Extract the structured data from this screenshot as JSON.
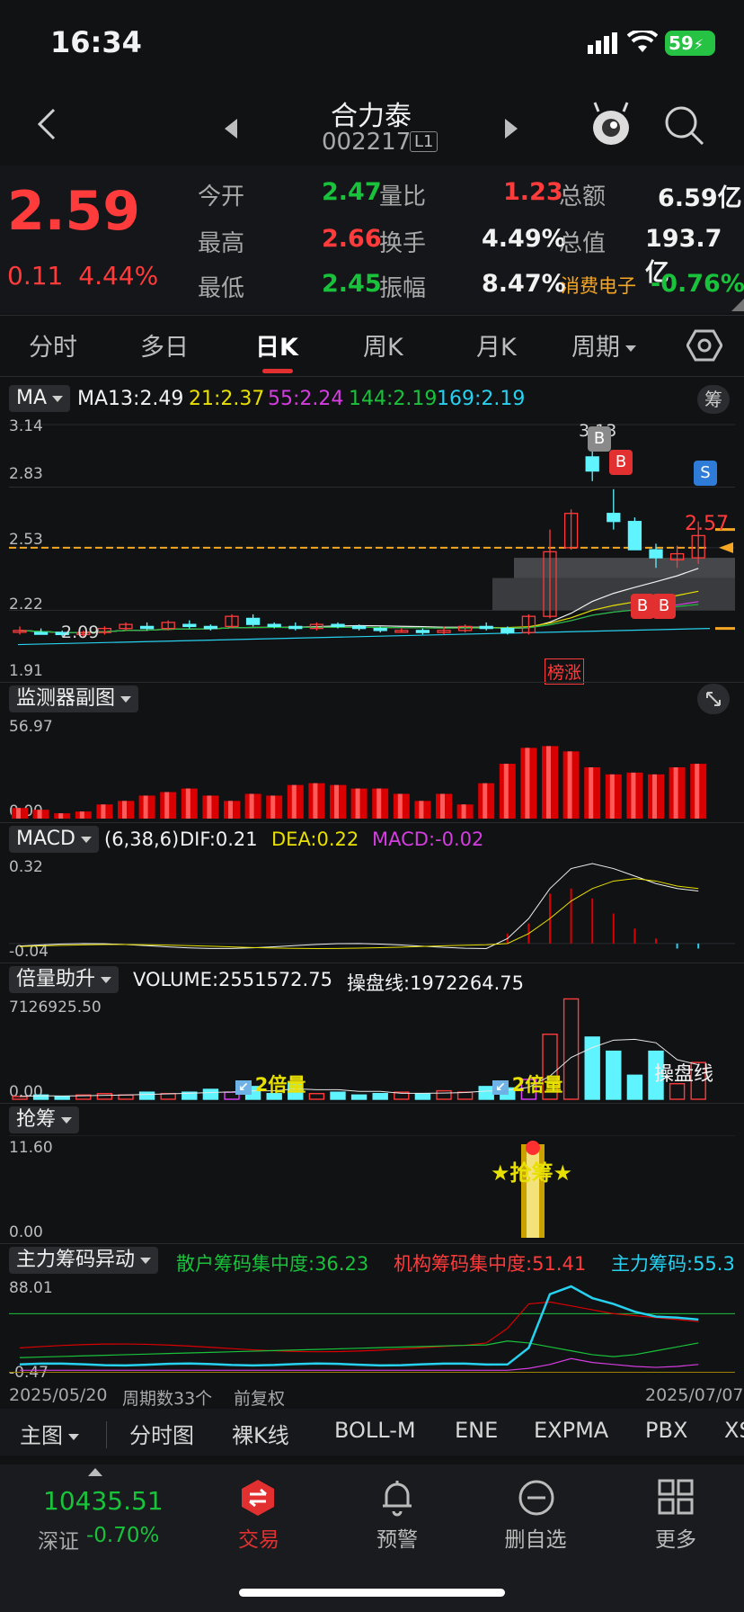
{
  "status": {
    "time": "16:34",
    "battery": "59"
  },
  "header": {
    "name": "合力泰",
    "code": "002217",
    "badge": "L1"
  },
  "quote": {
    "price": "2.59",
    "change": "0.11",
    "pct": "4.44%",
    "open_l": "今开",
    "open_v": "2.47",
    "ratio_l": "量比",
    "ratio_v": "1.23",
    "amount_l": "总额",
    "amount_v": "6.59亿",
    "high_l": "最高",
    "high_v": "2.66",
    "turn_l": "换手",
    "turn_v": "4.49%",
    "mcap_l": "总值",
    "mcap_v": "193.7亿",
    "low_l": "最低",
    "low_v": "2.45",
    "amp_l": "振幅",
    "amp_v": "8.47%",
    "sector_l": "消费电子",
    "sector_v": "-0.76%"
  },
  "tabs": [
    "分时",
    "多日",
    "日K",
    "周K",
    "月K",
    "周期"
  ],
  "ma": {
    "label": "MA",
    "ma13": "MA13:2.49",
    "ma21": "21:2.37",
    "ma55": "55:2.24",
    "ma144": "144:2.19",
    "ma169": "169:2.19",
    "chip": "筹"
  },
  "main_axis": {
    "y1": "3.14",
    "y2": "2.83",
    "y3": "2.53",
    "y4": "2.22",
    "y5": "1.91",
    "low_mark": "2.09",
    "high_mark": "3.13",
    "last": "2.57",
    "tag": "榜涨"
  },
  "markers": {
    "b": "B",
    "s": "S"
  },
  "monitor": {
    "label": "监测器副图",
    "top": "56.97",
    "bottom": "0.00"
  },
  "macd": {
    "label": "MACD",
    "params": "(6,38,6)",
    "dif": "DIF:0.21",
    "dea": "DEA:0.22",
    "macd": "MACD:-0.02",
    "top": "0.32",
    "bottom": "-0.04"
  },
  "vol": {
    "label": "倍量助升",
    "volume": "VOLUME:2551572.75",
    "line": "操盘线:1972264.75",
    "top": "7126925.50",
    "bottom": "0.00",
    "double1": "2倍量",
    "double2": "2倍量",
    "line_tag": "操盘线"
  },
  "qiang": {
    "label": "抢筹",
    "top": "11.60",
    "bottom": "0.00",
    "sign": "★抢筹★"
  },
  "chips": {
    "label": "主力筹码异动",
    "retail": "散户筹码集中度:36.23",
    "inst": "机构筹码集中度:51.41",
    "main": "主力筹码:55.3",
    "top": "88.01",
    "bottom": "-0.47"
  },
  "range": {
    "start": "2025/05/20",
    "count": "周期数33个",
    "adj": "前复权",
    "end": "2025/07/07"
  },
  "indicators": [
    "主图",
    "分时图",
    "裸K线",
    "BOLL-M",
    "ENE",
    "EXPMA",
    "PBX",
    "XS"
  ],
  "bottom_nav": {
    "index_val": "10435.51",
    "index_name": "深证",
    "index_pct": "-0.70%",
    "trade": "交易",
    "alert": "预警",
    "remove": "删自选",
    "more": "更多"
  },
  "colors": {
    "up": "#ff3b3b",
    "down": "#19c23b",
    "bg": "#111214"
  },
  "chart_data": {
    "type": "candlestick",
    "candles": [
      [
        2.12,
        2.14,
        2.1,
        2.12
      ],
      [
        2.11,
        2.13,
        2.1,
        2.11
      ],
      [
        2.11,
        2.12,
        2.09,
        2.1
      ],
      [
        2.1,
        2.12,
        2.09,
        2.11
      ],
      [
        2.11,
        2.14,
        2.1,
        2.13
      ],
      [
        2.13,
        2.16,
        2.12,
        2.15
      ],
      [
        2.14,
        2.16,
        2.12,
        2.13
      ],
      [
        2.13,
        2.17,
        2.12,
        2.16
      ],
      [
        2.15,
        2.17,
        2.13,
        2.14
      ],
      [
        2.14,
        2.15,
        2.12,
        2.13
      ],
      [
        2.14,
        2.2,
        2.13,
        2.19
      ],
      [
        2.18,
        2.2,
        2.14,
        2.15
      ],
      [
        2.15,
        2.16,
        2.13,
        2.14
      ],
      [
        2.14,
        2.16,
        2.12,
        2.13
      ],
      [
        2.13,
        2.16,
        2.12,
        2.15
      ],
      [
        2.15,
        2.16,
        2.13,
        2.14
      ],
      [
        2.14,
        2.15,
        2.12,
        2.13
      ],
      [
        2.13,
        2.14,
        2.11,
        2.12
      ],
      [
        2.12,
        2.13,
        2.11,
        2.12
      ],
      [
        2.12,
        2.13,
        2.1,
        2.11
      ],
      [
        2.11,
        2.14,
        2.1,
        2.12
      ],
      [
        2.12,
        2.15,
        2.11,
        2.14
      ],
      [
        2.14,
        2.16,
        2.12,
        2.13
      ],
      [
        2.13,
        2.14,
        2.1,
        2.11
      ],
      [
        2.11,
        2.2,
        2.1,
        2.19
      ],
      [
        2.19,
        2.62,
        2.18,
        2.51
      ],
      [
        2.53,
        2.72,
        2.52,
        2.7
      ],
      [
        2.98,
        3.13,
        2.86,
        2.91
      ],
      [
        2.7,
        2.82,
        2.62,
        2.66
      ],
      [
        2.66,
        2.68,
        2.52,
        2.52
      ],
      [
        2.52,
        2.55,
        2.43,
        2.48
      ],
      [
        2.47,
        2.54,
        2.43,
        2.5
      ],
      [
        2.48,
        2.66,
        2.45,
        2.59
      ]
    ],
    "up_flags": [
      1,
      0,
      0,
      1,
      1,
      1,
      0,
      1,
      0,
      0,
      1,
      0,
      0,
      0,
      1,
      0,
      0,
      0,
      1,
      0,
      1,
      1,
      0,
      0,
      1,
      1,
      1,
      0,
      0,
      0,
      0,
      1,
      1
    ],
    "monitor_values": [
      6,
      5,
      3,
      4,
      8,
      10,
      13,
      15,
      17,
      13,
      10,
      14,
      13,
      19,
      20,
      19,
      17,
      17,
      14,
      10,
      14,
      8,
      20,
      31,
      40,
      41,
      38,
      29,
      25,
      26,
      25,
      29,
      31
    ],
    "macd_bars": [
      0,
      0,
      0,
      0,
      0,
      0,
      0,
      0,
      0,
      0,
      0,
      0,
      0,
      0,
      0,
      0,
      0,
      0,
      0,
      0,
      0,
      0,
      0,
      0.04,
      0.08,
      0.2,
      0.22,
      0.18,
      0.12,
      0.06,
      0.02,
      -0.02,
      -0.02
    ],
    "volume_values": [
      0.2,
      0.3,
      0.2,
      0.3,
      0.4,
      0.3,
      0.5,
      0.4,
      0.5,
      0.7,
      0.5,
      0.9,
      0.4,
      1.2,
      0.4,
      0.5,
      0.3,
      0.4,
      0.5,
      0.4,
      0.6,
      0.5,
      0.9,
      0.8,
      1.4,
      4.6,
      7.1,
      4.4,
      3.4,
      1.7,
      3.4,
      1.1,
      2.6
    ],
    "ylim": [
      1.91,
      3.14
    ]
  }
}
